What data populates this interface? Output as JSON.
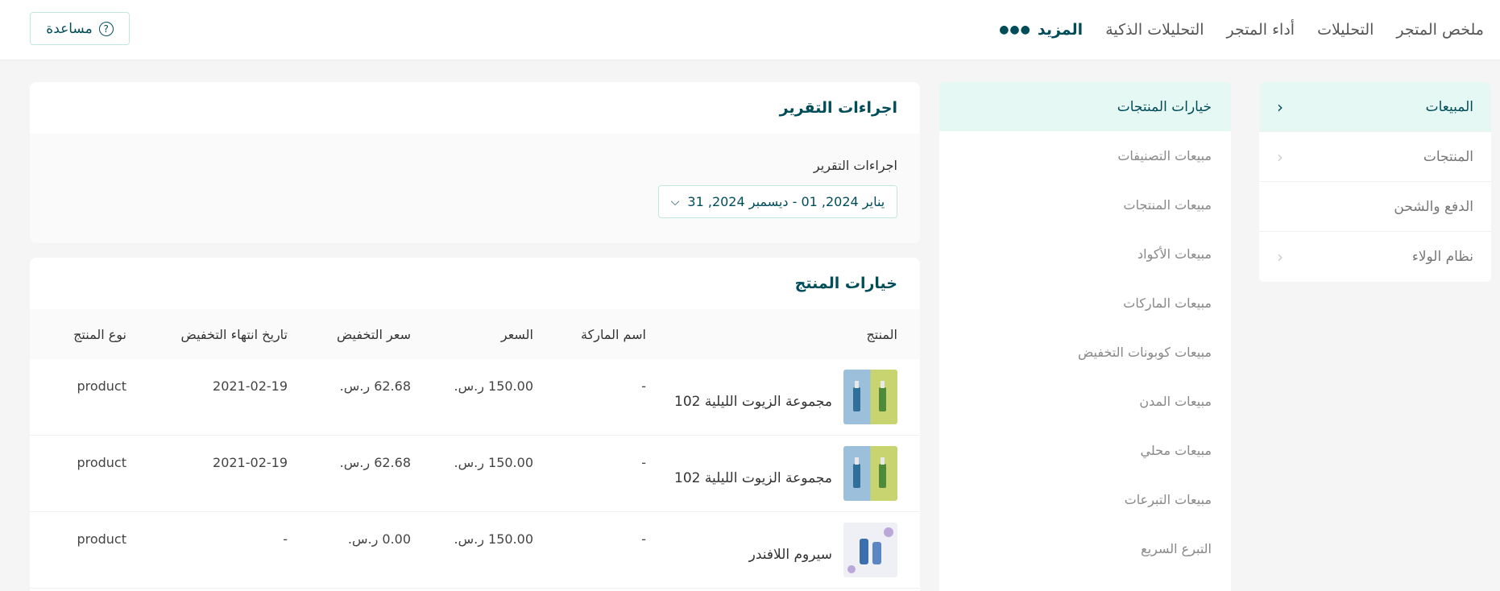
{
  "topnav": {
    "items": [
      "ملخص المتجر",
      "التحليلات",
      "أداء المتجر",
      "التحليلات الذكية"
    ],
    "more_label": "المزيد",
    "help_label": "مساعدة"
  },
  "sidebar": {
    "items": [
      {
        "label": "المبيعات",
        "active": true
      },
      {
        "label": "المنتجات"
      },
      {
        "label": "الدفع والشحن"
      },
      {
        "label": "نظام الولاء"
      }
    ]
  },
  "submenu": {
    "title": "خيارات المنتجات",
    "items": [
      "مبيعات التصنيفات",
      "مبيعات المنتجات",
      "مبيعات الأكواد",
      "مبيعات الماركات",
      "مبيعات كوبونات التخفيض",
      "مبيعات المدن",
      "مبيعات محلي",
      "مبيعات التبرعات",
      "التبرع السريع"
    ]
  },
  "report_actions": {
    "title": "اجراءات التقرير",
    "label": "اجراءات التقرير",
    "date_range": "يناير 2024, 01 - ديسمبر 2024, 31"
  },
  "product_table": {
    "title": "خيارات المنتج",
    "headers": {
      "product": "المنتج",
      "brand": "اسم الماركة",
      "price": "السعر",
      "discount_price": "سعر التخفيض",
      "discount_end": "تاريخ انتهاء التخفيض",
      "type": "نوع المنتج"
    },
    "rows": [
      {
        "product": "مجموعة الزيوت الليلية 102",
        "brand": "-",
        "price": "150.00 ر.س.",
        "discount_price": "62.68 ر.س.",
        "discount_end": "2021-02-19",
        "type": "product"
      },
      {
        "product": "مجموعة الزيوت الليلية 102",
        "brand": "-",
        "price": "150.00 ر.س.",
        "discount_price": "62.68 ر.س.",
        "discount_end": "2021-02-19",
        "type": "product"
      },
      {
        "product": "سيروم اللافندر",
        "brand": "-",
        "price": "150.00 ر.س.",
        "discount_price": "0.00 ر.س.",
        "discount_end": "-",
        "type": "product"
      }
    ]
  },
  "colors": {
    "accent": "#004d5a",
    "active_bg": "#e6f8f3",
    "border": "#bfe8e0"
  }
}
